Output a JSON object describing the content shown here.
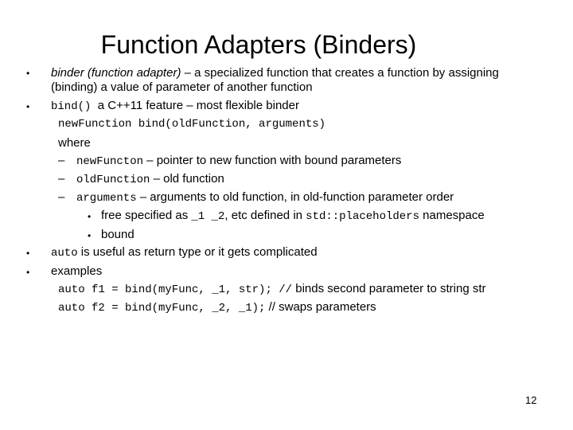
{
  "slide": {
    "title": "Function Adapters (Binders)",
    "page_number": "12",
    "bullet1": {
      "term": "binder (function adapter)",
      "rest": " – a specialized function that creates a function by assigning",
      "line2": "(binding) a value of parameter of another function"
    },
    "bullet2": {
      "code": "bind()",
      "text": "  a C++11 feature – most flexible binder",
      "signature": "newFunction bind(oldFunction, arguments)",
      "where": "where",
      "items": [
        {
          "code": "newFuncton",
          "text": " – pointer to new function with bound parameters"
        },
        {
          "code": "oldFunction",
          "text": " – old function"
        },
        {
          "code": "arguments",
          "text": " – arguments to old function, in old-function parameter order"
        }
      ],
      "subitems": [
        {
          "pre": "free specified as ",
          "code1": "_1 _2",
          "mid": ", etc defined in ",
          "code2": "std::placeholders",
          "post": " namespace"
        },
        {
          "text": "bound"
        }
      ]
    },
    "bullet3": {
      "code": "auto",
      "text": " is useful as return type or it gets complicated"
    },
    "bullet4": {
      "text": "examples",
      "examples": [
        {
          "code": "auto f1 = bind(myFunc, _1, str); //",
          "comment": " binds second parameter to string str"
        },
        {
          "code": "auto f2 = bind(myFunc, _2, _1);",
          "comment": " // swaps parameters"
        }
      ]
    },
    "symbols": {
      "bullet": "•",
      "dash": "–"
    }
  }
}
